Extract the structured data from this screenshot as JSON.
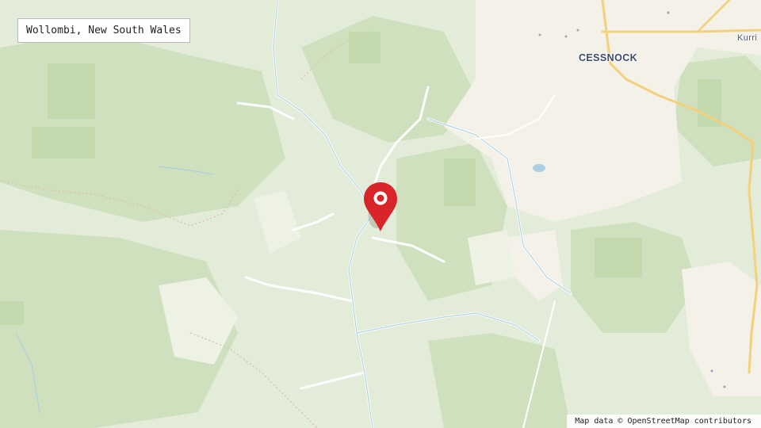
{
  "map": {
    "place_label": "Wollombi, New South Wales",
    "towns": [
      {
        "name": "CESSNOCK"
      },
      {
        "name": "Kurri"
      }
    ],
    "attribution": "Map data © OpenStreetMap contributors",
    "marker": {
      "icon": "map-pin-icon",
      "color": "#d8252a"
    },
    "colors": {
      "land": "#e6eedb",
      "forest": "#cfe0bf",
      "forest_dark": "#bfd6ac",
      "urban": "#f5f2ea",
      "water": "#a9cfe0",
      "road": "#f3d17a"
    }
  }
}
